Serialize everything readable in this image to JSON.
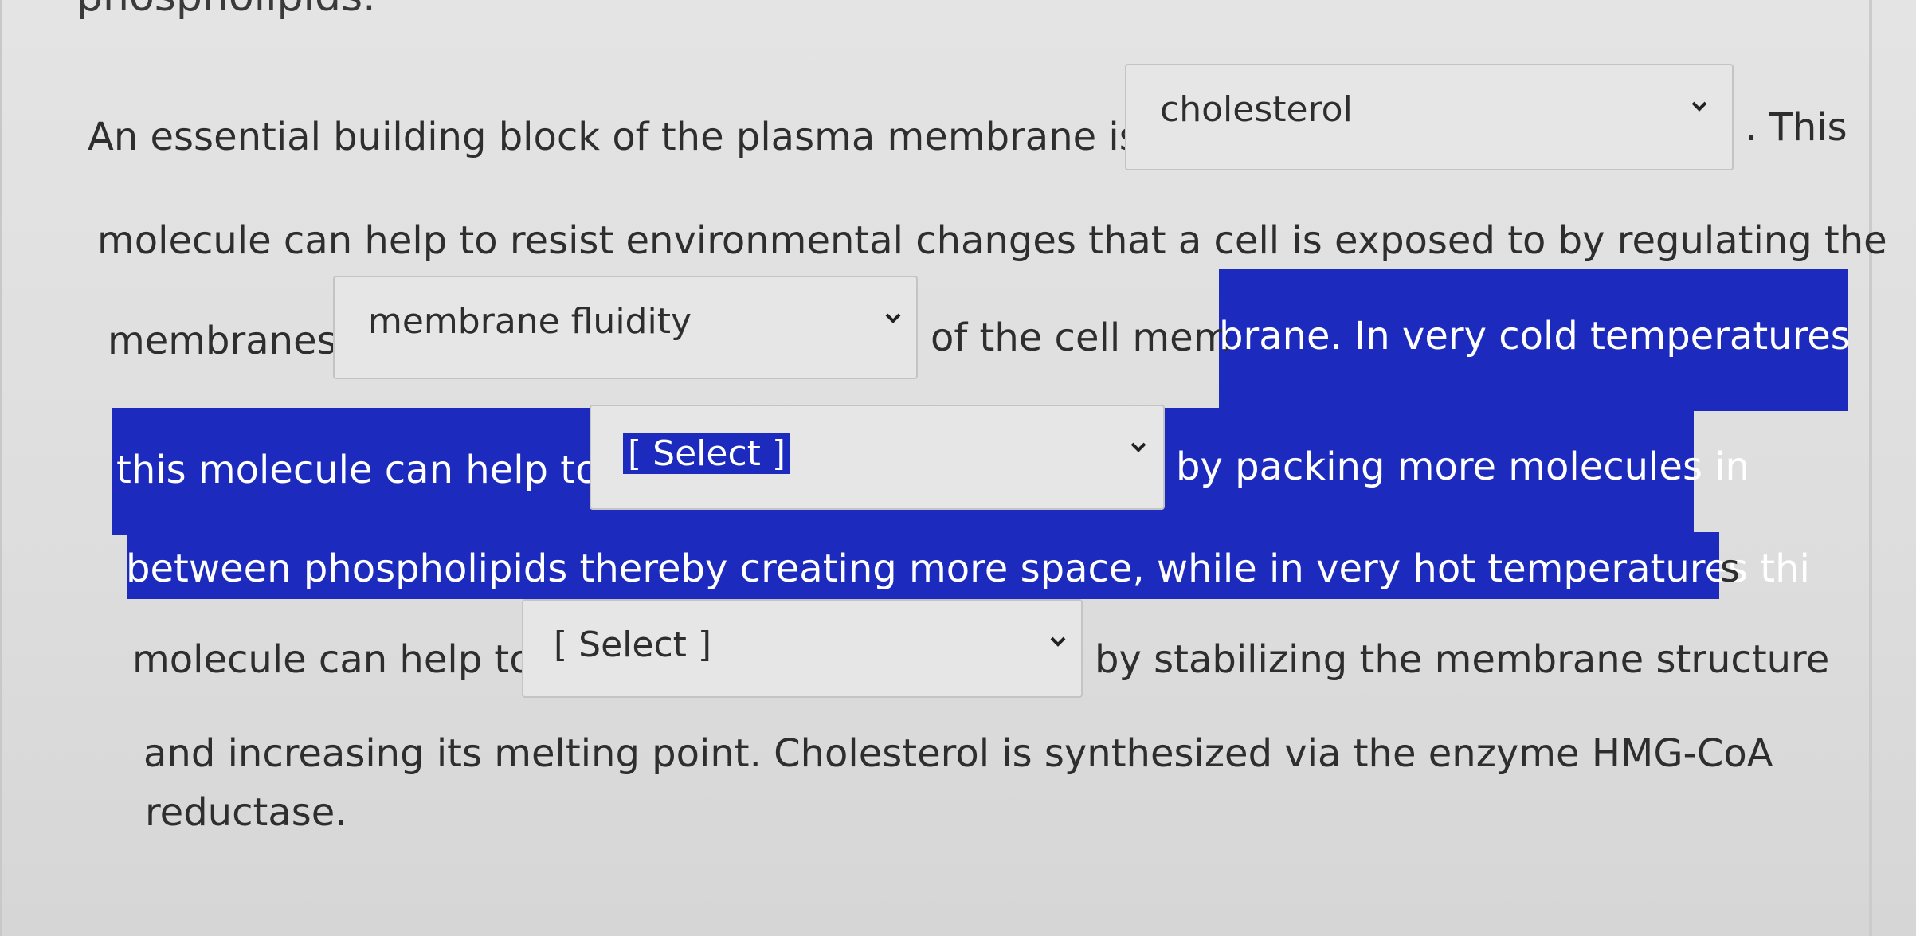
{
  "header": {
    "partial_text": "phospholipids."
  },
  "passage": {
    "line1_start": "An essential building block of the plasma membrane is",
    "line1_end": ". This",
    "line2": "molecule can help to resist environmental changes that a cell is exposed to by regulating the",
    "line3_start": "membranes",
    "line3_mid": "of the cell mem",
    "line3_hl": "brane. In very cold temperatures",
    "line4_hl_start": "this molecule can help to",
    "line4_hl_end": "by packing more molecules in",
    "line5_hl": "between phospholipids thereby creating more space, while in very hot temperatures thi",
    "line5_end": "s",
    "line6_start": "molecule can help to",
    "line6_end": "by stabilizing the membrane structure",
    "line7": "and increasing its melting point. Cholesterol is synthesized via the enzyme HMG-CoA",
    "line8": "reductase."
  },
  "dropdowns": {
    "d1": {
      "value": "cholesterol",
      "icon": "chevron-down-icon"
    },
    "d2": {
      "value": "membrane fluidity",
      "icon": "chevron-down-icon"
    },
    "d3": {
      "value": "[ Select ]",
      "icon": "chevron-down-icon"
    },
    "d4": {
      "value": "[ Select ]",
      "icon": "chevron-down-icon"
    }
  },
  "colors": {
    "highlight": "#1c2bbd",
    "text": "#2e2e2e",
    "background": "#e0e0e0"
  }
}
